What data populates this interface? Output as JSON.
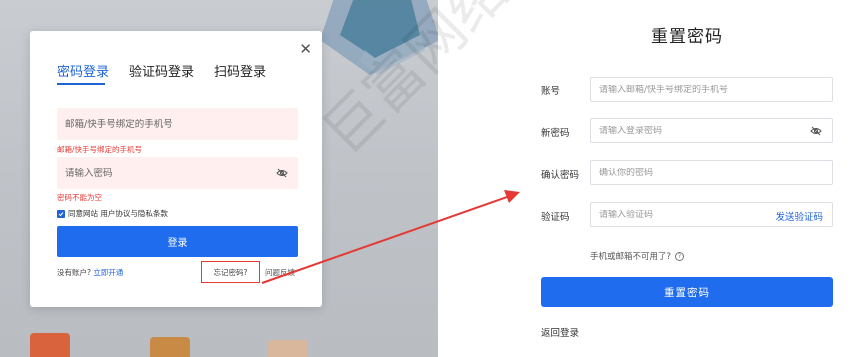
{
  "login_dialog": {
    "close_icon": "close-icon",
    "tabs": [
      {
        "label": "密码登录",
        "active": true
      },
      {
        "label": "验证码登录",
        "active": false
      },
      {
        "label": "扫码登录",
        "active": false
      }
    ],
    "account_placeholder": "邮箱/快手号绑定的手机号",
    "account_error": "邮箱/快手号绑定的手机号",
    "password_placeholder": "请输入密码",
    "password_error": "密码不能为空",
    "agree_text": "同意网站 用户协议与隐私条款",
    "login_button": "登录",
    "no_account": "没有账户?",
    "register_link": "立即开通",
    "forgot_link": "忘记密码?",
    "feedback_link": "问题反馈"
  },
  "reset_form": {
    "title": "重置密码",
    "account_label": "账号",
    "account_placeholder": "请输入邮箱/快手号绑定的手机号",
    "new_password_label": "新密码",
    "new_password_placeholder": "请输入登录密码",
    "confirm_label": "确认密码",
    "confirm_placeholder": "确认你的密码",
    "code_label": "验证码",
    "code_placeholder": "请输入验证码",
    "send_code": "发送验证码",
    "unavailable_text": "手机或邮箱不可用了?",
    "reset_button": "重置密码",
    "back_login": "返回登录"
  },
  "watermark": "巨富网络",
  "colors": {
    "accent": "#1f6dee",
    "error": "#e53935",
    "error_bg": "#ffefef",
    "annotation": "#e53935"
  }
}
